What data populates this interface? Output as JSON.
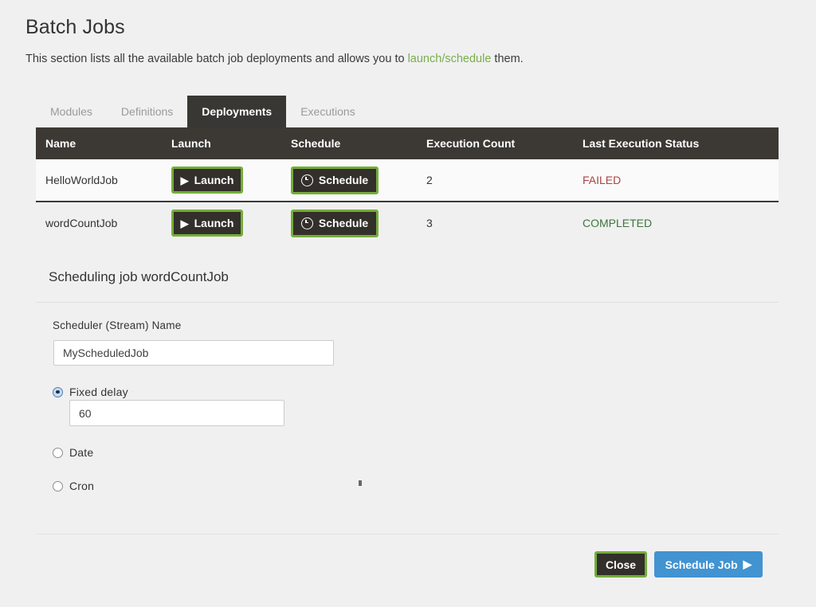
{
  "header": {
    "title": "Batch Jobs",
    "subtitle_prefix": "This section lists all the available batch job deployments and allows you to ",
    "link_launch": "launch",
    "separator": "/",
    "link_schedule": "schedule",
    "subtitle_suffix": " them."
  },
  "tabs": [
    {
      "label": "Modules",
      "active": false
    },
    {
      "label": "Definitions",
      "active": false
    },
    {
      "label": "Deployments",
      "active": true
    },
    {
      "label": "Executions",
      "active": false
    }
  ],
  "table": {
    "columns": [
      "Name",
      "Launch",
      "Schedule",
      "Execution Count",
      "Last Execution Status"
    ],
    "rows": [
      {
        "name": "HelloWorldJob",
        "launch_label": "Launch",
        "schedule_label": "Schedule",
        "execution_count": "2",
        "last_status": "FAILED",
        "status_color": "#a94442"
      },
      {
        "name": "wordCountJob",
        "launch_label": "Launch",
        "schedule_label": "Schedule",
        "execution_count": "3",
        "last_status": "COMPLETED",
        "status_color": "#3c763d"
      }
    ]
  },
  "form": {
    "heading": "Scheduling job wordCountJob",
    "scheduler_name_label": "Scheduler (Stream) Name",
    "scheduler_name_value": "MyScheduledJob",
    "scheduler_name_placeholder": "",
    "options": [
      {
        "label": "Fixed delay",
        "selected": true
      },
      {
        "label": "Date",
        "selected": false
      },
      {
        "label": "Cron",
        "selected": false
      }
    ],
    "fixed_delay_value": "60",
    "fixed_delay_placeholder": ""
  },
  "footer": {
    "close_label": "Close",
    "primary_label": "Schedule Job"
  },
  "colors": {
    "background": "#f0f0f0",
    "dark": "#393733",
    "focus_ring": "#74ad3a",
    "link_green": "#7aad4c",
    "primary_blue": "#4193d1",
    "status_failed": "#a94442",
    "status_completed": "#3c763d"
  },
  "icons": {
    "play": "▶",
    "clock": "clock-icon"
  }
}
